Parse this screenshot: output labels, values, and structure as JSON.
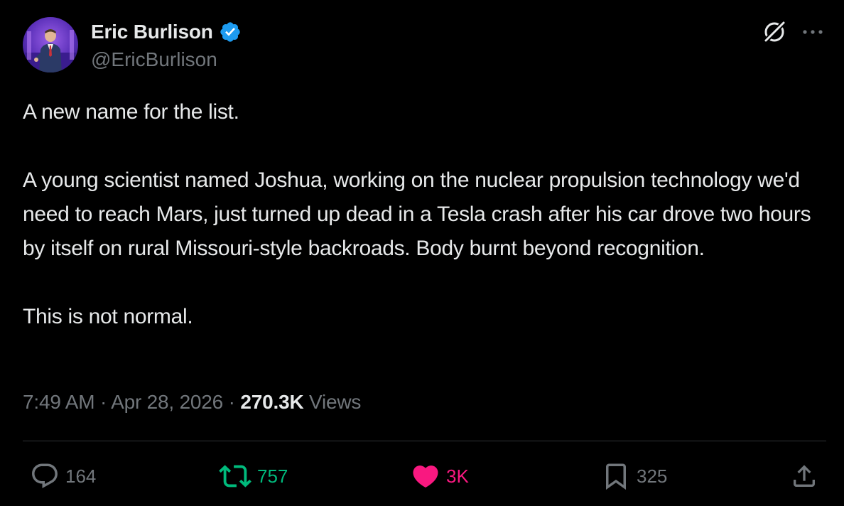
{
  "author": {
    "name": "Eric Burlison",
    "handle": "@EricBurlison",
    "verified": true
  },
  "tweet": {
    "paragraphs": [
      "A new name for the list.",
      "A young scientist named Joshua, working on the nuclear propulsion technology we'd need to reach Mars, just turned up dead in a Tesla crash after his car drove two hours by itself on rural Missouri-style backroads. Body burnt beyond recognition.",
      "This is not normal."
    ]
  },
  "meta": {
    "time": "7:49 AM",
    "separator": "·",
    "date": "Apr 28, 2026",
    "views_count": "270.3K",
    "views_label": "Views"
  },
  "actions": {
    "replies": "164",
    "reposts": "757",
    "likes": "3K",
    "bookmarks": "325"
  },
  "icons": {
    "header": [
      "grok-icon",
      "more-icon"
    ],
    "actions": [
      "reply-icon",
      "repost-icon",
      "like-icon",
      "bookmark-icon",
      "share-icon"
    ]
  },
  "colors": {
    "background": "#000000",
    "text": "#e7e9ea",
    "secondary": "#71767b",
    "verified": "#1d9bf0",
    "repost_active": "#00ba7c",
    "like_active": "#f91880",
    "divider": "#2f3336"
  }
}
